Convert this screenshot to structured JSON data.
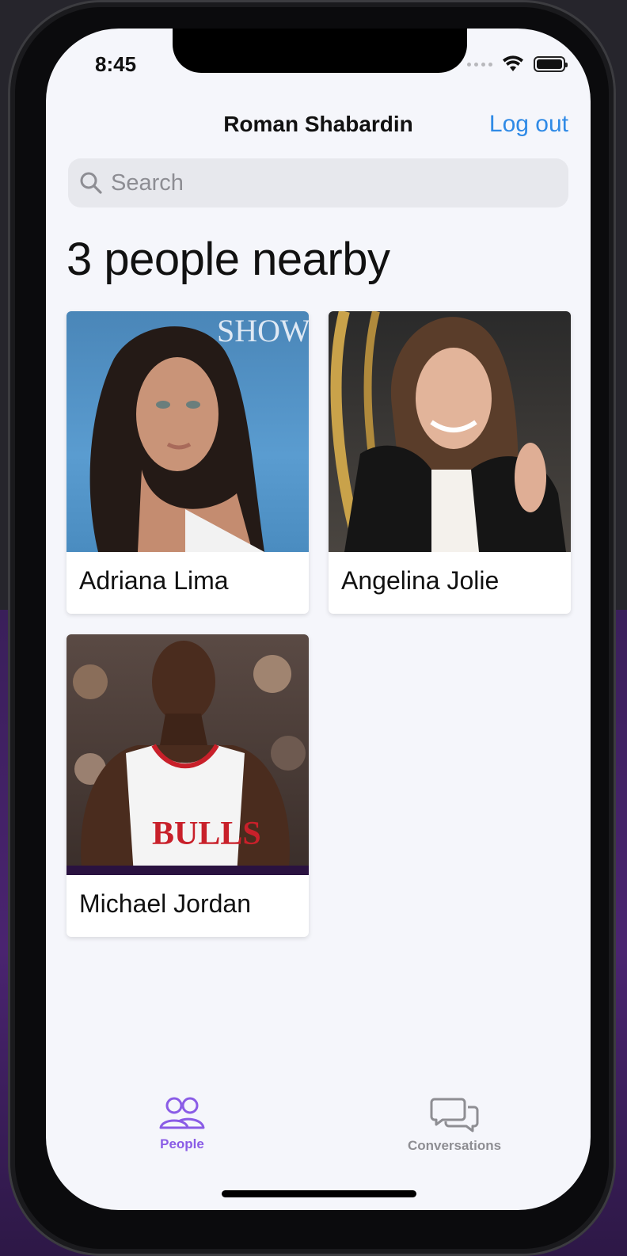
{
  "status_bar": {
    "time": "8:45"
  },
  "nav": {
    "title": "Roman Shabardin",
    "logout_label": "Log out"
  },
  "search": {
    "placeholder": "Search"
  },
  "heading": "3 people nearby",
  "people": [
    {
      "name": "Adriana Lima"
    },
    {
      "name": "Angelina Jolie"
    },
    {
      "name": "Michael Jordan"
    }
  ],
  "photo_texts": {
    "adriana_backdrop": "SHOW",
    "michael_jersey": "BULLS"
  },
  "tabs": [
    {
      "label": "People",
      "icon": "people-icon",
      "active": true
    },
    {
      "label": "Conversations",
      "icon": "chat-bubbles-icon",
      "active": false
    }
  ],
  "colors": {
    "accent": "#2f8ae6",
    "tab_active": "#8a5ce6",
    "tab_inactive": "#8e8e93",
    "background": "#f5f6fb"
  }
}
